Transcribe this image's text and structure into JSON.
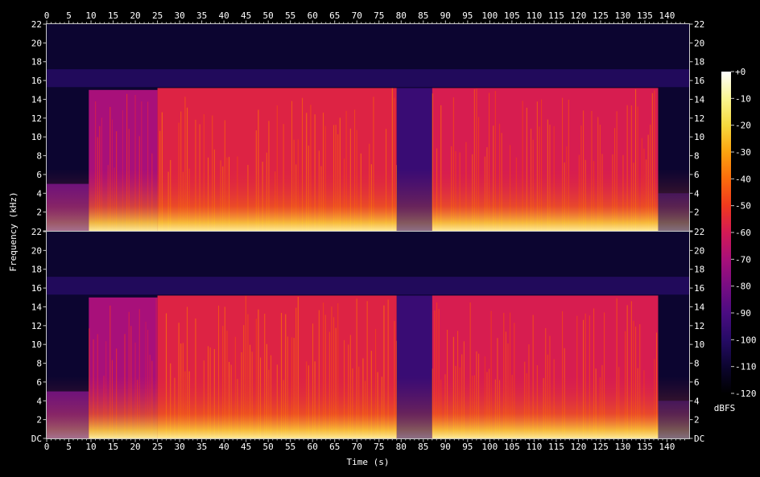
{
  "chart_data": {
    "type": "heatmap",
    "subtype": "spectrogram",
    "channels": 2,
    "xlabel": "Time (s)",
    "ylabel": "Frequency (kHz)",
    "xlim": [
      0,
      145
    ],
    "ylim": [
      0,
      22
    ],
    "x_ticks": [
      0,
      5,
      10,
      15,
      20,
      25,
      30,
      35,
      40,
      45,
      50,
      55,
      60,
      65,
      70,
      75,
      80,
      85,
      90,
      95,
      100,
      105,
      110,
      115,
      120,
      125,
      130,
      135,
      140
    ],
    "y_ticks": [
      0,
      2,
      4,
      6,
      8,
      10,
      12,
      14,
      16,
      18,
      20,
      22
    ],
    "y_tick_labels_top": [
      "22",
      "20",
      "18",
      "16",
      "14",
      "12",
      "10",
      "8",
      "6",
      "4",
      "2",
      "22"
    ],
    "y_tick_labels_bottom": [
      "22",
      "20",
      "18",
      "16",
      "14",
      "12",
      "10",
      "8",
      "6",
      "4",
      "2",
      "DC"
    ],
    "colorbar": {
      "label": "dBFS",
      "range": [
        -120,
        0
      ],
      "ticks": [
        "+0",
        "-10",
        "-20",
        "-30",
        "-40",
        "-50",
        "-60",
        "-70",
        "-80",
        "-90",
        "-100",
        "-110",
        "-120"
      ],
      "colors": [
        "#000000",
        "#0c0530",
        "#260b66",
        "#4b0c82",
        "#780d83",
        "#a8107a",
        "#d41a55",
        "#f1391e",
        "#fb6c0c",
        "#fca30f",
        "#f6d93e",
        "#fbf691",
        "#ffffff"
      ]
    },
    "segments": [
      {
        "start": 0,
        "end": 9.5,
        "cutoff_khz": 5,
        "level_db": -85
      },
      {
        "start": 9.5,
        "end": 25,
        "cutoff_khz": 15,
        "level_db": -70
      },
      {
        "start": 25,
        "end": 79,
        "cutoff_khz": 15.2,
        "level_db": -57
      },
      {
        "start": 79,
        "end": 87,
        "cutoff_khz": 15.2,
        "level_db": -95
      },
      {
        "start": 87,
        "end": 138,
        "cutoff_khz": 15.2,
        "level_db": -59
      },
      {
        "start": 138,
        "end": 145,
        "cutoff_khz": 4,
        "level_db": -100
      }
    ],
    "noise_floor_db": -110,
    "grid": false
  }
}
